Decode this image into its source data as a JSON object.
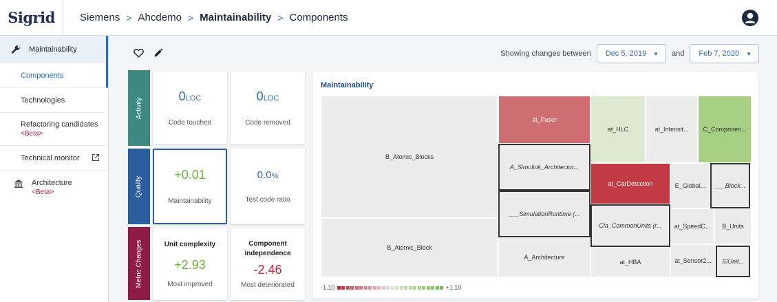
{
  "header": {
    "logo": "Sigrid",
    "breadcrumb": [
      "Siemens",
      "Ahcdemo",
      "Maintainability",
      "Components"
    ],
    "breadcrumb_sep": ">"
  },
  "sidebar": {
    "top": "Maintainability",
    "items": [
      "Components",
      "Technologies"
    ],
    "refactoring": "Refactoring candidates",
    "refactoring_tag": "<Beta>",
    "monitor": "Technical monitor",
    "architecture": "Architecture",
    "architecture_tag": "<Beta>"
  },
  "toolbar": {
    "range_label": "Showing changes between",
    "from": "Dec 5, 2019",
    "and": "and",
    "to": "Feb 7, 2020"
  },
  "categories": {
    "activity": "Activity",
    "quality": "Quality",
    "metric": "Metric Changes"
  },
  "cards": {
    "code_touched": {
      "value": "0",
      "unit": "LOC",
      "caption": "Code touched"
    },
    "code_removed": {
      "value": "0",
      "unit": "LOC",
      "caption": "Code removed"
    },
    "maintainability": {
      "value": "+0.01",
      "caption": "Maintainability"
    },
    "test_ratio": {
      "value": "0.0",
      "unit": "%",
      "caption": "Test code ratio"
    },
    "unit_complexity": {
      "title": "Unit complexity",
      "value": "+2.93",
      "caption": "Most improved"
    },
    "component_independence": {
      "title": "Component independence",
      "value": "-2.46",
      "caption": "Most deteriorated"
    }
  },
  "treemap": {
    "title": "Maintainability",
    "cells": [
      {
        "label": "B_Atomic_Blocks"
      },
      {
        "label": "B_Atomic_Block"
      },
      {
        "label": "at_Fuser"
      },
      {
        "label": "A_Simulink_Architectur..."
      },
      {
        "label": "___SimulationRuntime (..."
      },
      {
        "label": "A_Architecture"
      },
      {
        "label": "at_HLC"
      },
      {
        "label": "at_Intensit..."
      },
      {
        "label": "C_Componen..."
      },
      {
        "label": "at_CarDetection"
      },
      {
        "label": "E_Global..."
      },
      {
        "label": "___Block..."
      },
      {
        "label": "Cla_CommonUnits (r..."
      },
      {
        "label": "at_SpeedC..."
      },
      {
        "label": "B_Units"
      },
      {
        "label": "at_HBA"
      },
      {
        "label": "at_Sensor2..."
      },
      {
        "label": "SIUnit..."
      }
    ],
    "legend_min": "-1.10",
    "legend_max": "+1.10",
    "colors": {
      "neutral": "#ececec",
      "strong_red": "#c23c45",
      "mid_red": "#cf6e73",
      "light_green": "#dde9d0",
      "mid_green": "#a6cf82"
    }
  }
}
